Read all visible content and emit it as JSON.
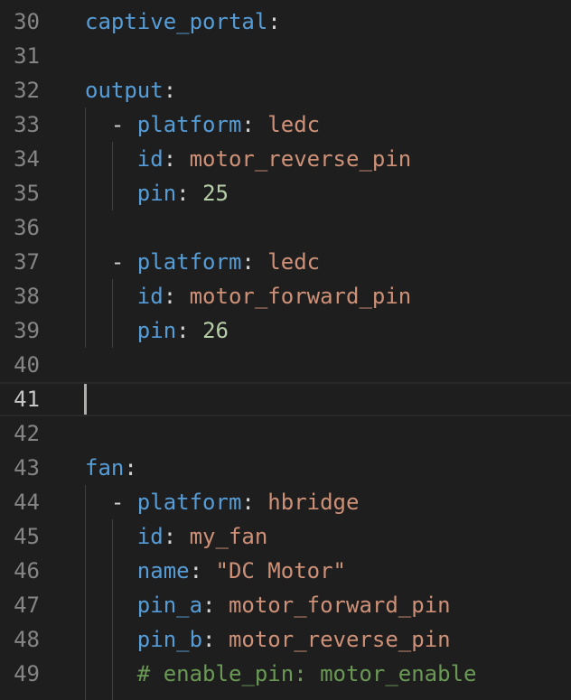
{
  "editor": {
    "current_line": "41",
    "lines": [
      {
        "num": "30",
        "indent": "",
        "key": "captive_portal",
        "sep": ":",
        "value": "",
        "num_value": ""
      },
      {
        "num": "31"
      },
      {
        "num": "32",
        "indent": "",
        "key": "output",
        "sep": ":",
        "value": "",
        "num_value": ""
      },
      {
        "num": "33",
        "indent": "  - ",
        "key": "platform",
        "sep": ": ",
        "value": "ledc",
        "num_value": ""
      },
      {
        "num": "34",
        "indent": "    ",
        "key": "id",
        "sep": ": ",
        "value": "motor_reverse_pin",
        "num_value": ""
      },
      {
        "num": "35",
        "indent": "    ",
        "key": "pin",
        "sep": ": ",
        "value": "",
        "num_value": "25"
      },
      {
        "num": "36"
      },
      {
        "num": "37",
        "indent": "  - ",
        "key": "platform",
        "sep": ": ",
        "value": "ledc",
        "num_value": ""
      },
      {
        "num": "38",
        "indent": "    ",
        "key": "id",
        "sep": ": ",
        "value": "motor_forward_pin",
        "num_value": ""
      },
      {
        "num": "39",
        "indent": "    ",
        "key": "pin",
        "sep": ": ",
        "value": "",
        "num_value": "26"
      },
      {
        "num": "40"
      },
      {
        "num": "41"
      },
      {
        "num": "42"
      },
      {
        "num": "43",
        "indent": "",
        "key": "fan",
        "sep": ":",
        "value": "",
        "num_value": ""
      },
      {
        "num": "44",
        "indent": "  - ",
        "key": "platform",
        "sep": ": ",
        "value": "hbridge",
        "num_value": ""
      },
      {
        "num": "45",
        "indent": "    ",
        "key": "id",
        "sep": ": ",
        "value": "my_fan",
        "num_value": ""
      },
      {
        "num": "46",
        "indent": "    ",
        "key": "name",
        "sep": ": ",
        "value": "\"DC Motor\"",
        "num_value": ""
      },
      {
        "num": "47",
        "indent": "    ",
        "key": "pin_a",
        "sep": ": ",
        "value": "motor_forward_pin",
        "num_value": ""
      },
      {
        "num": "48",
        "indent": "    ",
        "key": "pin_b",
        "sep": ": ",
        "value": "motor_reverse_pin",
        "num_value": ""
      },
      {
        "num": "49",
        "indent": "    ",
        "comment": "# enable_pin: motor_enable"
      }
    ]
  }
}
